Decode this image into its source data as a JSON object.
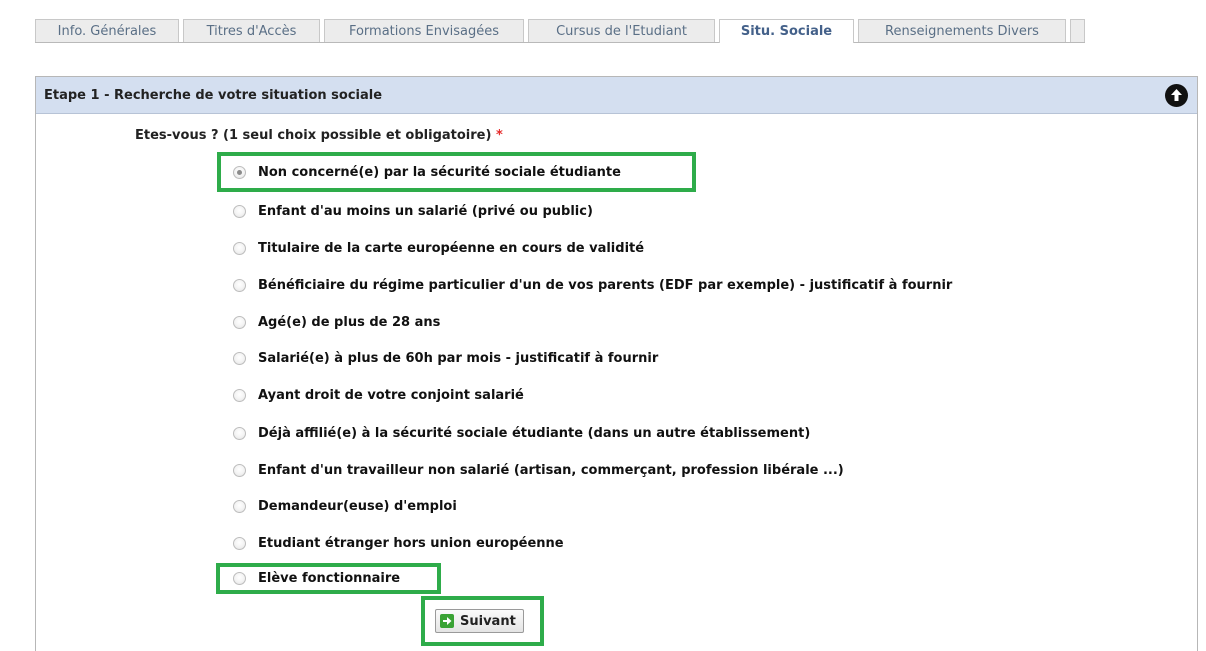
{
  "tabs": [
    {
      "label": "Info. Générales",
      "active": false
    },
    {
      "label": "Titres d'Accès",
      "active": false
    },
    {
      "label": "Formations Envisagées",
      "active": false
    },
    {
      "label": "Cursus de l'Etudiant",
      "active": false
    },
    {
      "label": "Situ. Sociale",
      "active": true
    },
    {
      "label": "Renseignements Divers",
      "active": false
    }
  ],
  "panel": {
    "title": "Etape 1 - Recherche de votre situation sociale",
    "collapse_icon": "arrow-up-circle-icon"
  },
  "question": {
    "label": "Etes-vous ? (1 seul choix possible et obligatoire)",
    "required_marker": "*"
  },
  "options": [
    {
      "label": "Non concerné(e) par la sécurité sociale étudiante",
      "checked": true
    },
    {
      "label": "Enfant d'au moins un salarié (privé ou public)",
      "checked": false
    },
    {
      "label": "Titulaire de la carte européenne en cours de validité",
      "checked": false
    },
    {
      "label": "Bénéficiaire du régime particulier d'un de vos parents (EDF par exemple) - justificatif à fournir",
      "checked": false
    },
    {
      "label": "Agé(e) de plus de 28 ans",
      "checked": false
    },
    {
      "label": "Salarié(e) à plus de 60h par mois - justificatif à fournir",
      "checked": false
    },
    {
      "label": "Ayant droit de votre conjoint salarié",
      "checked": false
    },
    {
      "label": "Déjà affilié(e) à la sécurité sociale étudiante (dans un autre établissement)",
      "checked": false
    },
    {
      "label": "Enfant d'un travailleur non salarié (artisan, commerçant, profession libérale ...)",
      "checked": false
    },
    {
      "label": "Demandeur(euse) d'emploi",
      "checked": false
    },
    {
      "label": "Etudiant étranger hors union européenne",
      "checked": false
    },
    {
      "label": "Elève fonctionnaire",
      "checked": false
    }
  ],
  "next_button": {
    "label": "Suivant",
    "icon": "arrow-right-icon"
  },
  "colors": {
    "highlight": "#2eac4a",
    "header_bg": "#d4dff0",
    "required": "#e52a2a",
    "active_tab_text": "#44618a"
  }
}
